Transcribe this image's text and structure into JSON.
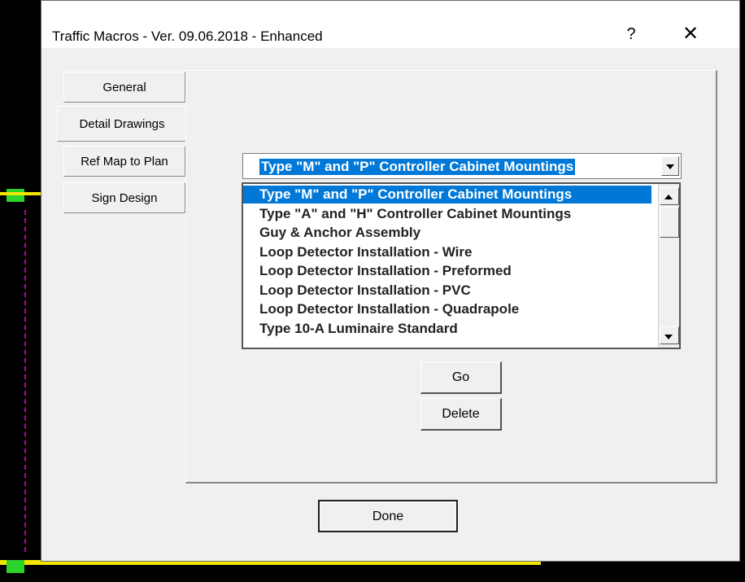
{
  "window": {
    "title": "Traffic Macros - Ver. 09.06.2018 - Enhanced",
    "help_glyph": "?",
    "close_glyph": "✕"
  },
  "tabs": [
    {
      "label": "General"
    },
    {
      "label": "Detail Drawings",
      "active": true
    },
    {
      "label": "Ref Map to Plan"
    },
    {
      "label": "Sign Design"
    }
  ],
  "drawing_select": {
    "selected": "Type \"M\" and \"P\" Controller Cabinet Mountings"
  },
  "drawing_list": {
    "items": [
      "Type \"M\" and \"P\" Controller Cabinet Mountings",
      "Type \"A\" and \"H\" Controller Cabinet Mountings",
      "Guy & Anchor Assembly",
      "Loop Detector Installation - Wire",
      "Loop Detector Installation - Preformed",
      "Loop Detector Installation - PVC",
      "Loop Detector Installation - Quadrapole",
      "Type 10-A Luminaire Standard"
    ],
    "selected_index": 0
  },
  "buttons": {
    "go": "Go",
    "delete": "Delete",
    "done": "Done"
  },
  "colors": {
    "selection": "#0078d7",
    "dialog_bg": "#f0f0f0",
    "cad_yellow": "#f2e600",
    "cad_green": "#2bd32b"
  }
}
